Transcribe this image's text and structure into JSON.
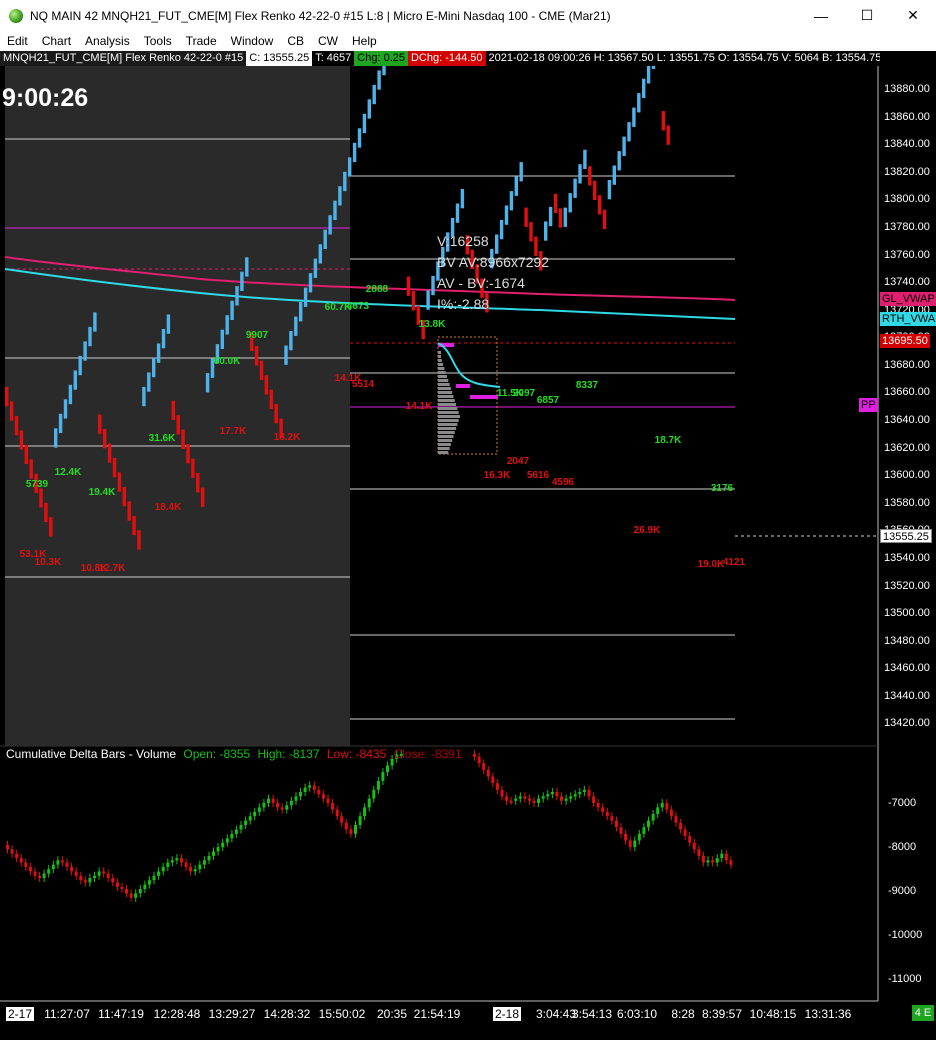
{
  "window": {
    "title": "NQ MAIN 42 MNQH21_FUT_CME[M]  Flex Renko 42-22-0  #15 L:8 | Micro E-Mini Nasdaq 100 - CME (Mar21)",
    "minimize": "—",
    "maximize": "☐",
    "close": "✕"
  },
  "menu": [
    "Edit",
    "Chart",
    "Analysis",
    "Tools",
    "Trade",
    "Window",
    "CB",
    "CW",
    "Help"
  ],
  "infobar": {
    "symbol": "MNQH21_FUT_CME[M]  Flex Renko 42-22-0  #15",
    "close": "C: 13555.25",
    "ticks": "T: 4657",
    "chg": "Chg: 0.25",
    "dchg": "DChg: -144.50",
    "bar_info": "2021-02-18 09:00:26 H: 13567.50  L: 13551.75  O: 13554.75  V: 5064  B: 13554.75"
  },
  "clock": "9:00:26",
  "overlay": {
    "lines": [
      "V:16258",
      "BV AV:8966x7292",
      "AV - BV:-1674",
      "I%:-2.88"
    ]
  },
  "price_axis": {
    "labels": [
      "13880.00",
      "13860.00",
      "13840.00",
      "13820.00",
      "13800.00",
      "13780.00",
      "13760.00",
      "13740.00",
      "13720.00",
      "13700.00",
      "13680.00",
      "13660.00",
      "13640.00",
      "13620.00",
      "13600.00",
      "13580.00",
      "13560.00",
      "13540.00",
      "13520.00",
      "13500.00",
      "13480.00",
      "13460.00",
      "13440.00",
      "13420.00"
    ],
    "last_price": "13555.25",
    "gl_vwap": "GL_VWAP",
    "rth_vwap": "RTH_VWA",
    "level_tag": "13695.50",
    "pp_tag": "PP"
  },
  "delta_axis": {
    "labels": [
      "-7000",
      "-8000",
      "-9000",
      "-10000",
      "-11000"
    ]
  },
  "indicator": {
    "name": "Cumulative Delta Bars - Volume",
    "open": "Open: -8355",
    "high": "High: -8137",
    "low": "Low: -8435",
    "close": "Close: -8391"
  },
  "time_axis": [
    {
      "label": "2-17",
      "boxed": true
    },
    {
      "label": "11:27:07"
    },
    {
      "label": "11:47:19"
    },
    {
      "label": "12:28:48"
    },
    {
      "label": "13:29:27"
    },
    {
      "label": "14:28:32"
    },
    {
      "label": "15:50:02"
    },
    {
      "label": "20:35"
    },
    {
      "label": "21:54:19"
    },
    {
      "label": "2-18",
      "boxed": true
    },
    {
      "label": "3:04:43"
    },
    {
      "label": "3:54:13"
    },
    {
      "label": "6:03:10"
    },
    {
      "label": "8:28"
    },
    {
      "label": "8:39:57"
    },
    {
      "label": "10:48:15"
    },
    {
      "label": "13:31:36"
    }
  ],
  "corner": "4 E",
  "volume_labels": [
    {
      "text": "5739",
      "c": "g"
    },
    {
      "text": "12.4K",
      "c": "g"
    },
    {
      "text": "19.4K",
      "c": "g"
    },
    {
      "text": "53.1K",
      "c": "r"
    },
    {
      "text": "10.3K",
      "c": "r"
    },
    {
      "text": "10.8K",
      "c": "r"
    },
    {
      "text": "12.7K",
      "c": "r"
    },
    {
      "text": "31.6K",
      "c": "g"
    },
    {
      "text": "18.4K",
      "c": "r"
    },
    {
      "text": "60.0K",
      "c": "g"
    },
    {
      "text": "9907",
      "c": "g"
    },
    {
      "text": "17.7K",
      "c": "r"
    },
    {
      "text": "18.2K",
      "c": "r"
    },
    {
      "text": "60.7K",
      "c": "g"
    },
    {
      "text": "4673",
      "c": "g"
    },
    {
      "text": "2888",
      "c": "g"
    },
    {
      "text": "14.1K",
      "c": "r"
    },
    {
      "text": "5514",
      "c": "r"
    },
    {
      "text": "13.8K",
      "c": "g"
    },
    {
      "text": "14.1K",
      "c": "r"
    },
    {
      "text": "11.5K",
      "c": "g"
    },
    {
      "text": "2097",
      "c": "g"
    },
    {
      "text": "6857",
      "c": "g"
    },
    {
      "text": "8337",
      "c": "g"
    },
    {
      "text": "2047",
      "c": "r"
    },
    {
      "text": "16.3K",
      "c": "r"
    },
    {
      "text": "5616",
      "c": "r"
    },
    {
      "text": "4596",
      "c": "r"
    },
    {
      "text": "18.7K",
      "c": "g"
    },
    {
      "text": "26.9K",
      "c": "r"
    },
    {
      "text": "3176",
      "c": "g"
    },
    {
      "text": "19.0K",
      "c": "r"
    },
    {
      "text": "4121",
      "c": "r"
    }
  ],
  "colors": {
    "bull": "#4fb3ea",
    "bear": "#e01010",
    "vol_green": "#22dd22",
    "vol_red": "#e01010",
    "gl_vwap": "#e0206e",
    "rth_vwap": "#2fd9e6",
    "magenta": "#e020e0",
    "delta_up": "#16c016",
    "delta_down": "#e01010"
  }
}
